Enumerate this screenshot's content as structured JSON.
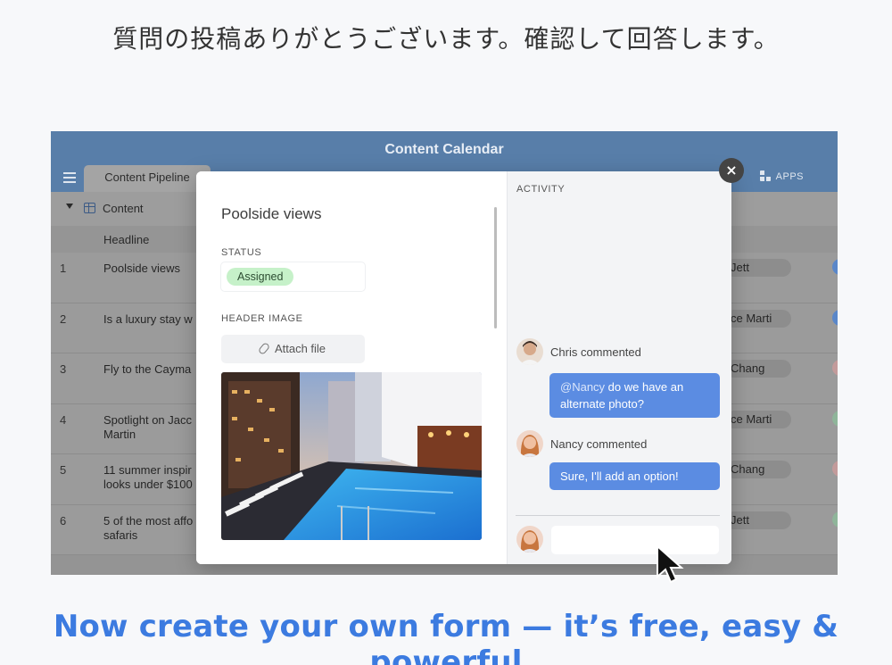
{
  "top_message": "質問の投稿ありがとうございます。確認して回答します。",
  "app": {
    "title": "Content Calendar",
    "active_tab": "Content Pipeline",
    "apps_label": "APPS",
    "table_name": "Content",
    "column_headline": "Headline"
  },
  "rows": [
    {
      "num": "1",
      "headline": "Poolside views",
      "assignee": "Jett",
      "dot_color": "#5a87c9"
    },
    {
      "num": "2",
      "headline": "Is a luxury stay w",
      "assignee": "ce Marti",
      "dot_color": "#5a87c9"
    },
    {
      "num": "3",
      "headline": "Fly to the Cayma",
      "assignee": "Chang",
      "dot_color": "#c39b9b"
    },
    {
      "num": "4",
      "headline": "Spotlight on Jacc Martin",
      "assignee": "ce Marti",
      "dot_color": "#8fb59a"
    },
    {
      "num": "5",
      "headline": "11 summer inspir looks under $100",
      "assignee": "Chang",
      "dot_color": "#c39b9b"
    },
    {
      "num": "6",
      "headline": "5 of the most affo safaris",
      "assignee": "Jett",
      "dot_color": "#8fb59a"
    }
  ],
  "modal": {
    "record_title": "Poolside views",
    "status_label": "STATUS",
    "status_value": "Assigned",
    "header_image_label": "HEADER IMAGE",
    "attach_label": "Attach file",
    "activity_label": "ACTIVITY",
    "comments": [
      {
        "author": "Chris commented",
        "mention": "@Nancy",
        "text": " do we have an alternate photo?"
      },
      {
        "author": "Nancy commented",
        "text": "Sure, I'll add an option!"
      }
    ],
    "close_symbol": "×"
  },
  "cta": "Now create your own form — it’s free, easy & powerful",
  "colors": {
    "accent": "#3c7be0",
    "bubble": "#5b8ce2",
    "status_green": "#c6f1c9",
    "header_blue": "#587ea9"
  }
}
